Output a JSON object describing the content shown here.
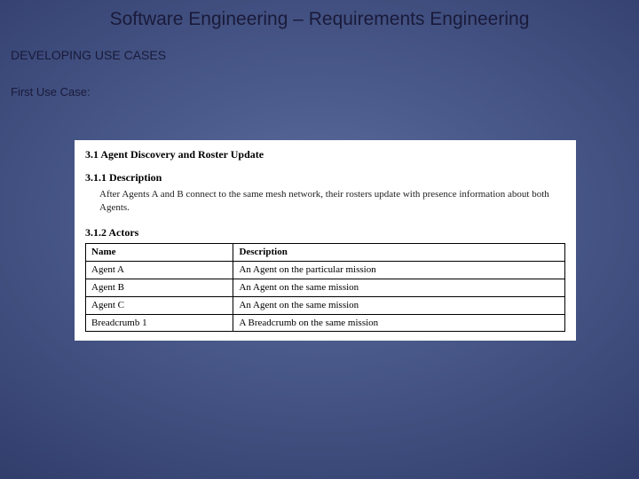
{
  "slide": {
    "title": "Software Engineering – Requirements Engineering",
    "section_heading": "DEVELOPING USE CASES",
    "sub_heading": "First Use Case:"
  },
  "doc": {
    "heading_3_1": "3.1 Agent Discovery and Roster Update",
    "heading_3_1_1": "3.1.1 Description",
    "description": "After Agents A and B connect to the same mesh network, their rosters update with presence information about both Agents.",
    "heading_3_1_2": "3.1.2 Actors",
    "table": {
      "headers": {
        "name": "Name",
        "description": "Description"
      },
      "rows": [
        {
          "name": "Agent A",
          "description": "An Agent on the particular mission"
        },
        {
          "name": "Agent B",
          "description": "An Agent on the same mission"
        },
        {
          "name": "Agent C",
          "description": "An Agent on the same mission"
        },
        {
          "name": "Breadcrumb 1",
          "description": "A Breadcrumb on the same mission"
        }
      ]
    }
  }
}
